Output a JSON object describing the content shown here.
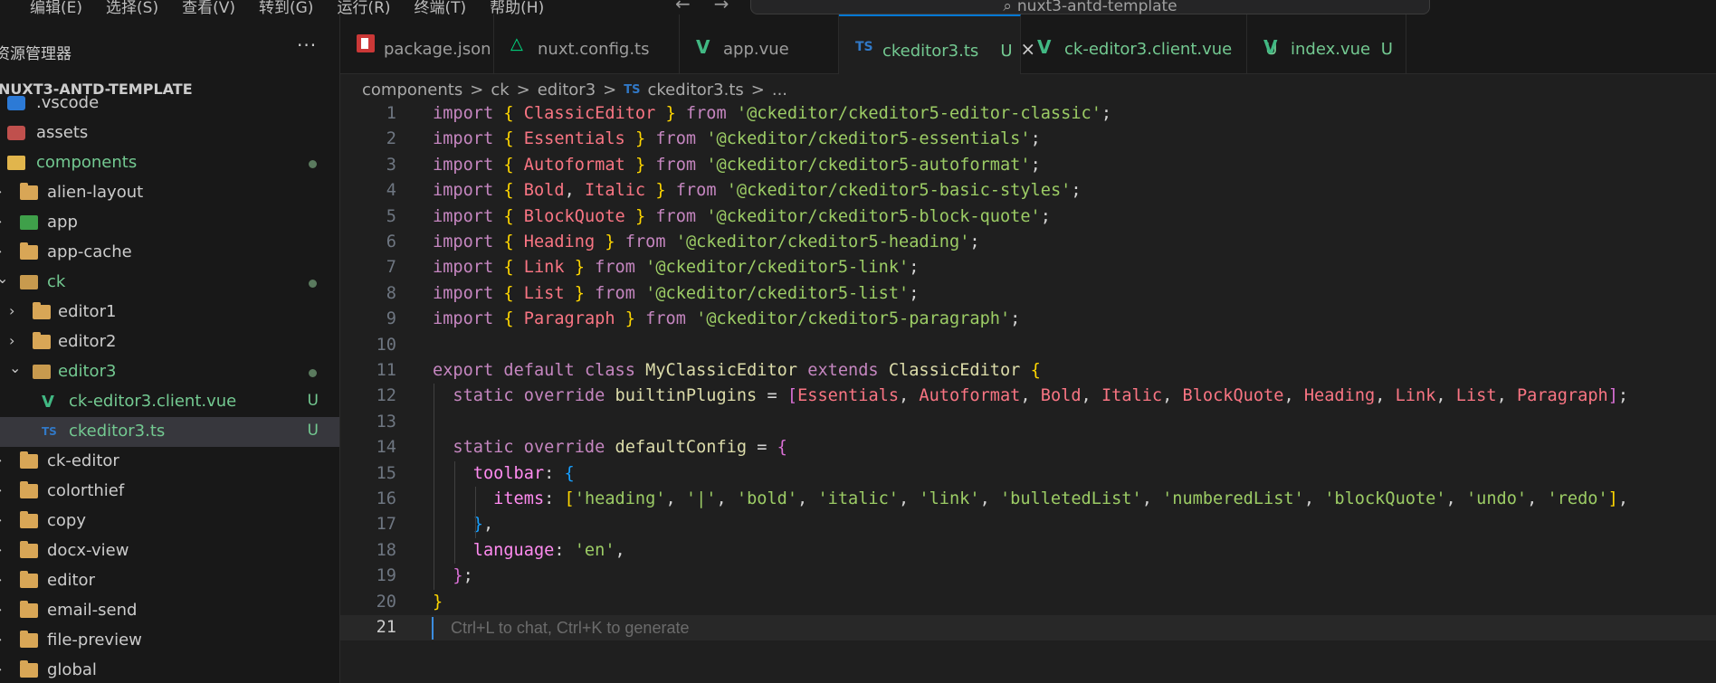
{
  "menu": [
    "）",
    "编辑(E)",
    "选择(S)",
    "查看(V)",
    "转到(G)",
    "运行(R)",
    "终端(T)",
    "帮助(H)"
  ],
  "command_center": {
    "text": "nuxt3-antd-template",
    "icon": "search-icon"
  },
  "sidebar": {
    "title": "资源管理器",
    "more": "···",
    "root": "NUXT3-ANTD-TEMPLATE",
    "items": [
      {
        "label": ".vscode",
        "icon": "vscode-folder-icon"
      },
      {
        "label": "assets",
        "icon": "assets-folder-icon"
      },
      {
        "label": "components",
        "icon": "components-folder-icon",
        "dot": true
      },
      {
        "label": "alien-layout",
        "icon": "folder-icon"
      },
      {
        "label": "app",
        "icon": "app-folder-icon"
      },
      {
        "label": "app-cache",
        "icon": "folder-icon"
      },
      {
        "label": "ck",
        "icon": "folder-open-icon",
        "dot": true
      },
      {
        "label": "editor1",
        "icon": "folder-icon"
      },
      {
        "label": "editor2",
        "icon": "folder-icon"
      },
      {
        "label": "editor3",
        "icon": "folder-open-icon",
        "dot": true
      },
      {
        "label": "ck-editor3.client.vue",
        "icon": "vue-file-icon",
        "badge": "U"
      },
      {
        "label": "ckeditor3.ts",
        "icon": "ts-file-icon",
        "badge": "U"
      },
      {
        "label": "ck-editor",
        "icon": "folder-icon"
      },
      {
        "label": "colorthief",
        "icon": "folder-icon"
      },
      {
        "label": "copy",
        "icon": "folder-icon"
      },
      {
        "label": "docx-view",
        "icon": "folder-icon"
      },
      {
        "label": "editor",
        "icon": "folder-icon"
      },
      {
        "label": "email-send",
        "icon": "folder-icon"
      },
      {
        "label": "file-preview",
        "icon": "folder-icon"
      },
      {
        "label": "global",
        "icon": "folder-icon"
      }
    ]
  },
  "tabs": [
    {
      "label": "package.json",
      "icon": "npm-icon"
    },
    {
      "label": "nuxt.config.ts",
      "icon": "nuxt-icon"
    },
    {
      "label": "app.vue",
      "icon": "vue-icon"
    },
    {
      "label": "ckeditor3.ts",
      "icon": "ts-icon",
      "badge": "U",
      "close": "×"
    },
    {
      "label": "ck-editor3.client.vue",
      "icon": "vue-icon",
      "badge": "U"
    },
    {
      "label": "index.vue",
      "icon": "vue-icon",
      "badge": "U"
    }
  ],
  "breadcrumb": [
    "components",
    "ck",
    "editor3",
    "ckeditor3.ts",
    "..."
  ],
  "breadcrumb_sep": ">",
  "breadcrumb_ts": "TS",
  "editor": {
    "line_numbers": [
      "1",
      "2",
      "3",
      "4",
      "5",
      "6",
      "7",
      "8",
      "9",
      "10",
      "11",
      "12",
      "13",
      "14",
      "15",
      "16",
      "17",
      "18",
      "19",
      "20",
      "21"
    ],
    "ghost_hint": "Ctrl+L to chat, Ctrl+K to generate",
    "imports": [
      {
        "names": [
          "ClassicEditor"
        ],
        "module": "'@ckeditor/ckeditor5-editor-classic'"
      },
      {
        "names": [
          "Essentials"
        ],
        "module": "'@ckeditor/ckeditor5-essentials'"
      },
      {
        "names": [
          "Autoformat"
        ],
        "module": "'@ckeditor/ckeditor5-autoformat'"
      },
      {
        "names": [
          "Bold",
          "Italic"
        ],
        "module": "'@ckeditor/ckeditor5-basic-styles'"
      },
      {
        "names": [
          "BlockQuote"
        ],
        "module": "'@ckeditor/ckeditor5-block-quote'"
      },
      {
        "names": [
          "Heading"
        ],
        "module": "'@ckeditor/ckeditor5-heading'"
      },
      {
        "names": [
          "Link"
        ],
        "module": "'@ckeditor/ckeditor5-link'"
      },
      {
        "names": [
          "List"
        ],
        "module": "'@ckeditor/ckeditor5-list'"
      },
      {
        "names": [
          "Paragraph"
        ],
        "module": "'@ckeditor/ckeditor5-paragraph'"
      }
    ],
    "class_name": "MyClassicEditor",
    "base_class": "ClassicEditor",
    "plugins": [
      "Essentials",
      "Autoformat",
      "Bold",
      "Italic",
      "BlockQuote",
      "Heading",
      "Link",
      "List",
      "Paragraph"
    ],
    "toolbar_items": [
      "'heading'",
      "'|'",
      "'bold'",
      "'italic'",
      "'link'",
      "'bulletedList'",
      "'numberedList'",
      "'blockQuote'",
      "'undo'",
      "'redo'"
    ],
    "language": "'en'"
  }
}
